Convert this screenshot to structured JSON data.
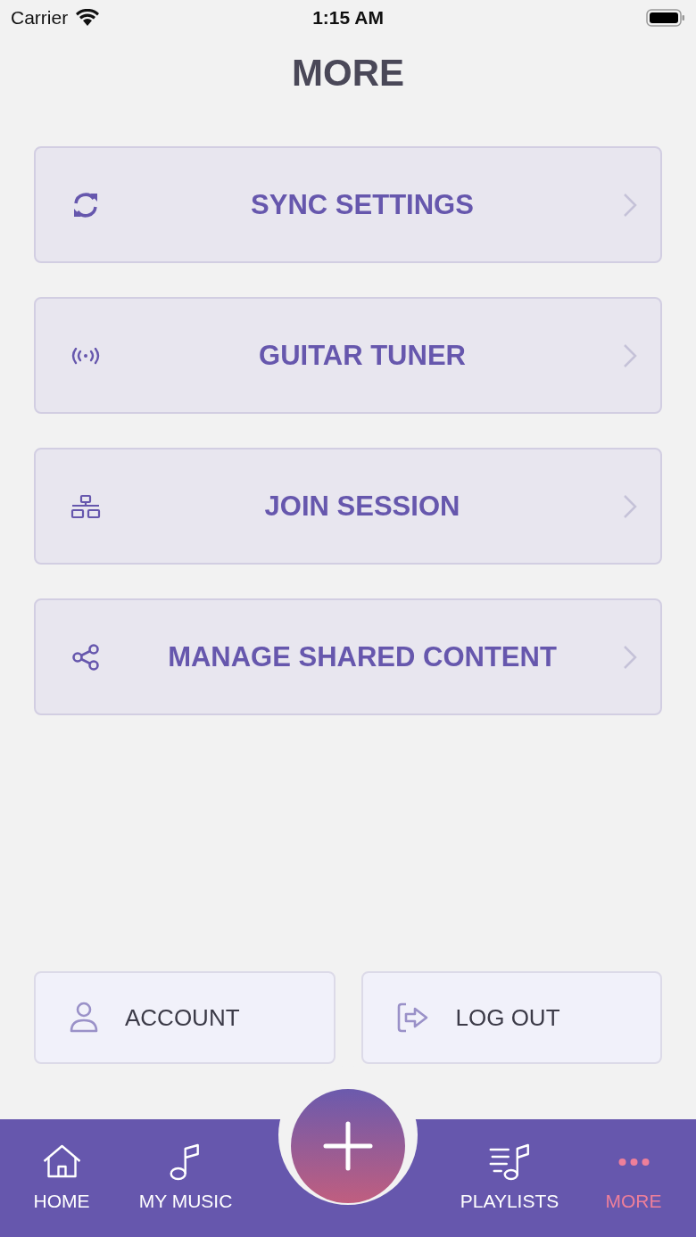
{
  "status_bar": {
    "carrier": "Carrier",
    "time": "1:15 AM"
  },
  "title": "MORE",
  "menu": [
    {
      "kind": "sync",
      "label": "SYNC SETTINGS"
    },
    {
      "kind": "tuner",
      "label": "GUITAR TUNER"
    },
    {
      "kind": "session",
      "label": "JOIN SESSION"
    },
    {
      "kind": "share",
      "label": "MANAGE SHARED CONTENT"
    }
  ],
  "actions": [
    {
      "kind": "account",
      "label": "ACCOUNT"
    },
    {
      "kind": "logout",
      "label": "LOG OUT"
    }
  ],
  "tabs": [
    {
      "kind": "home",
      "label": "HOME",
      "selected": false
    },
    {
      "kind": "music",
      "label": "MY MUSIC",
      "selected": false
    },
    {
      "kind": "playlists",
      "label": "PLAYLISTS",
      "selected": false
    },
    {
      "kind": "more",
      "label": "MORE",
      "selected": true
    }
  ]
}
